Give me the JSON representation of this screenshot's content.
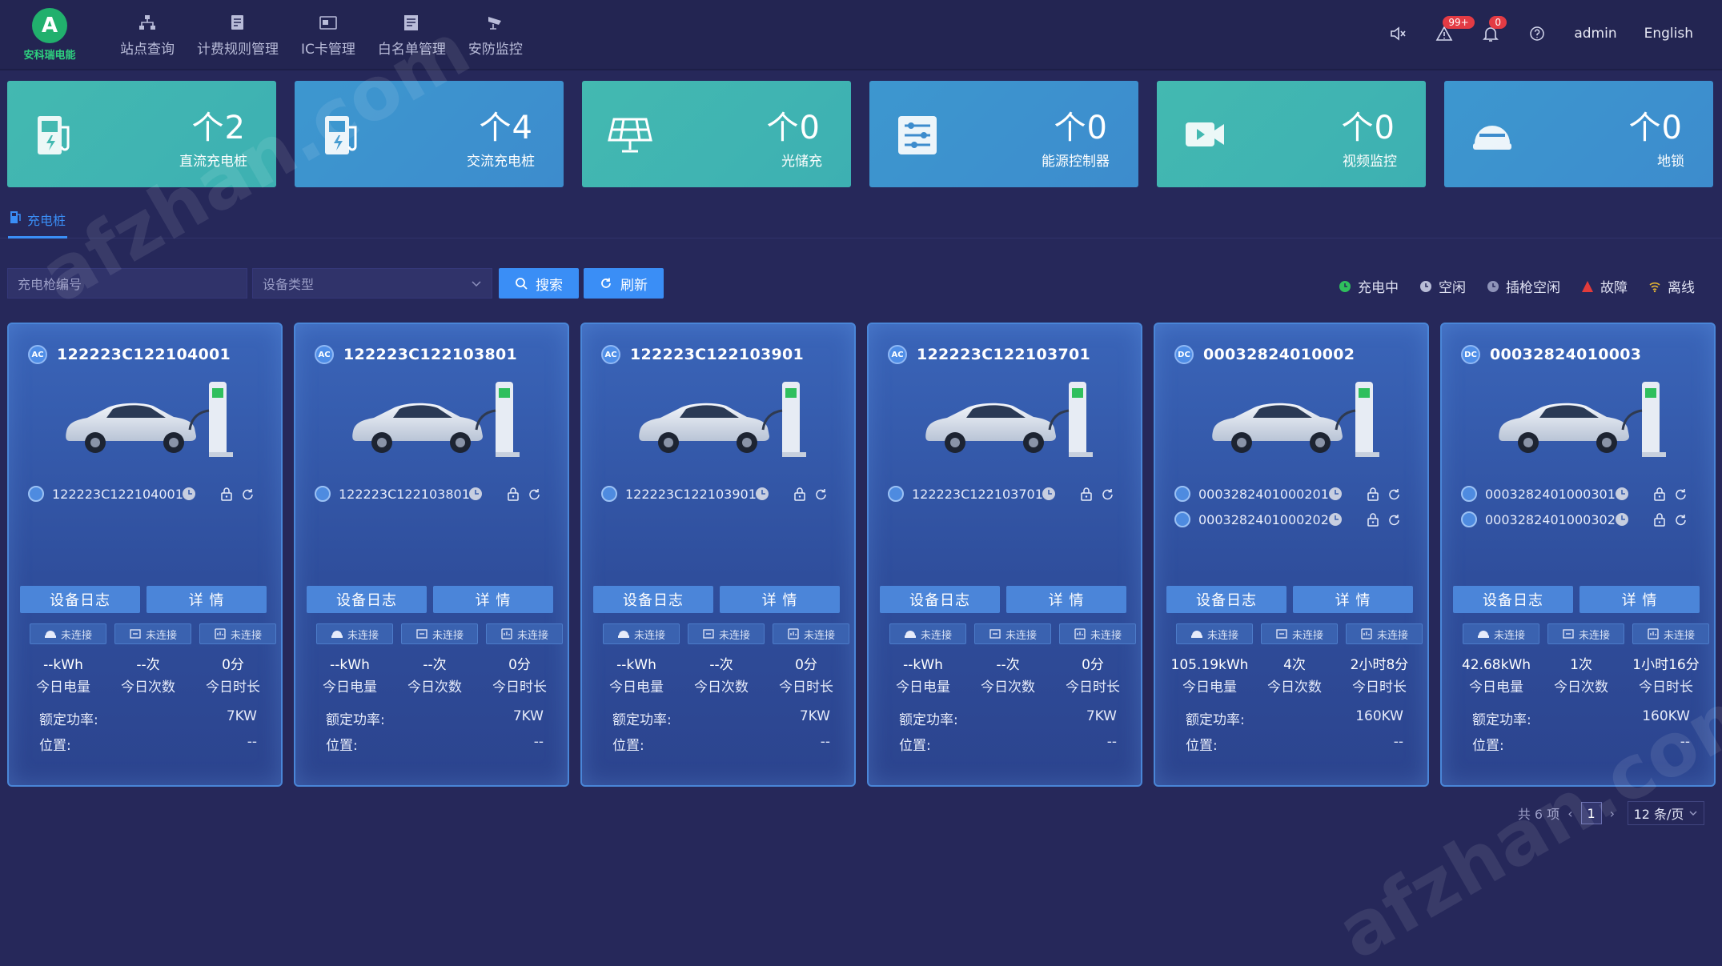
{
  "header": {
    "logo_text": "安科瑞电能",
    "nav": [
      {
        "label": "站点查询",
        "icon": "sitemap-icon"
      },
      {
        "label": "计费规则管理",
        "icon": "billing-icon"
      },
      {
        "label": "IC卡管理",
        "icon": "card-icon"
      },
      {
        "label": "白名单管理",
        "icon": "list-icon"
      },
      {
        "label": "安防监控",
        "icon": "camera-icon"
      }
    ],
    "alarm_badge": "99+",
    "notice_badge": "0",
    "user": "admin",
    "language": "English"
  },
  "stats": [
    {
      "value": "2",
      "label": "直流充电桩",
      "style": "teal",
      "icon": "dc-charger-icon"
    },
    {
      "value": "4",
      "label": "交流充电桩",
      "style": "blue",
      "icon": "ac-charger-icon"
    },
    {
      "value": "0",
      "label": "光储充",
      "style": "teal",
      "icon": "solar-panel-icon"
    },
    {
      "value": "0",
      "label": "能源控制器",
      "style": "blue",
      "icon": "energy-controller-icon"
    },
    {
      "value": "0",
      "label": "视频监控",
      "style": "teal",
      "icon": "video-camera-icon"
    },
    {
      "value": "0",
      "label": "地锁",
      "style": "blue",
      "icon": "ground-lock-icon"
    }
  ],
  "stat_prefix": "个",
  "tab": {
    "label": "充电桩"
  },
  "toolbar": {
    "search_placeholder": "充电枪编号",
    "device_type_placeholder": "设备类型",
    "search_label": "搜索",
    "refresh_label": "刷新"
  },
  "legend": [
    {
      "label": "充电中",
      "color": "#2fbf5d",
      "icon": "charging-status-icon"
    },
    {
      "label": "空闲",
      "color": "#b8bcd6",
      "icon": "idle-status-icon"
    },
    {
      "label": "插枪空闲",
      "color": "#8e93b8",
      "icon": "plugged-idle-status-icon"
    },
    {
      "label": "故障",
      "color": "#e23b3b",
      "icon": "fault-warning-icon"
    },
    {
      "label": "离线",
      "color": "#e3b434",
      "icon": "offline-wifi-icon"
    }
  ],
  "card_labels": {
    "log": "设备日志",
    "detail": "详 情",
    "conn_status": "未连接",
    "energy": "今日电量",
    "count": "今日次数",
    "duration": "今日时长",
    "rated_power": "额定功率:",
    "location": "位置:"
  },
  "cards": [
    {
      "type": "AC",
      "id": "122223C122104001",
      "guns": [
        "122223C122104001"
      ],
      "energy": "--kWh",
      "count": "--次",
      "duration": "0分",
      "power": "7KW",
      "location": "--"
    },
    {
      "type": "AC",
      "id": "122223C122103801",
      "guns": [
        "122223C122103801"
      ],
      "energy": "--kWh",
      "count": "--次",
      "duration": "0分",
      "power": "7KW",
      "location": "--"
    },
    {
      "type": "AC",
      "id": "122223C122103901",
      "guns": [
        "122223C122103901"
      ],
      "energy": "--kWh",
      "count": "--次",
      "duration": "0分",
      "power": "7KW",
      "location": "--"
    },
    {
      "type": "AC",
      "id": "122223C122103701",
      "guns": [
        "122223C122103701"
      ],
      "energy": "--kWh",
      "count": "--次",
      "duration": "0分",
      "power": "7KW",
      "location": "--"
    },
    {
      "type": "DC",
      "id": "00032824010002",
      "guns": [
        "0003282401000201",
        "0003282401000202"
      ],
      "energy": "105.19kWh",
      "count": "4次",
      "duration": "2小时8分",
      "power": "160KW",
      "location": "--"
    },
    {
      "type": "DC",
      "id": "00032824010003",
      "guns": [
        "0003282401000301",
        "0003282401000302"
      ],
      "energy": "42.68kWh",
      "count": "1次",
      "duration": "1小时16分",
      "power": "160KW",
      "location": "--"
    }
  ],
  "pagination": {
    "total": "共 6 项",
    "page": "1",
    "page_size": "12 条/页"
  },
  "watermark": [
    "afzhan.com",
    "afzhan.com"
  ]
}
